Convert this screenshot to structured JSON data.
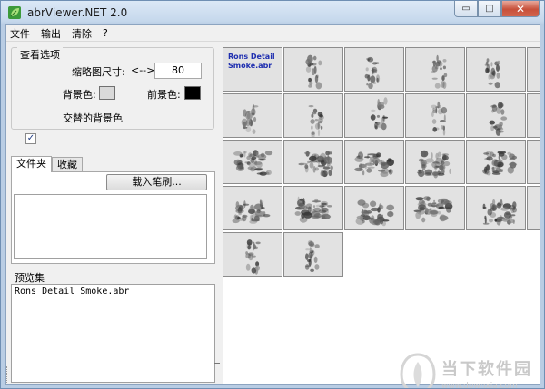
{
  "window": {
    "title": "abrViewer.NET 2.0",
    "controls": {
      "minimize": "▭",
      "maximize": "□",
      "close": "✕"
    }
  },
  "menu": [
    "文件",
    "输出",
    "清除",
    "?"
  ],
  "view_options": {
    "title": "查看选项",
    "thumb_size_label": "缩略图尺寸:",
    "thumb_size_arrows": "<-->",
    "thumb_size_value": "80",
    "background_label": "背景色:",
    "background_color": "#d9d9d9",
    "foreground_label": "前景色:",
    "foreground_color": "#000000",
    "alternate_bg_label": "交替的背景色",
    "alternate_bg_checked": true,
    "check_mark": "✓"
  },
  "tabs": [
    {
      "label": "文件夹",
      "active": true
    },
    {
      "label": "收藏",
      "active": false
    }
  ],
  "load_brushes_label": "载入笔刷...",
  "preview_set": {
    "label": "预览集",
    "items": [
      "Rons Detail Smoke.abr"
    ]
  },
  "brush_grid": {
    "first_cell_label": "Rons Detail Smoke.abr",
    "brush_count": 26,
    "cell_background": "#e2e2e2"
  },
  "watermark": {
    "text": "当下软件园",
    "url": "www.downxia.com"
  }
}
